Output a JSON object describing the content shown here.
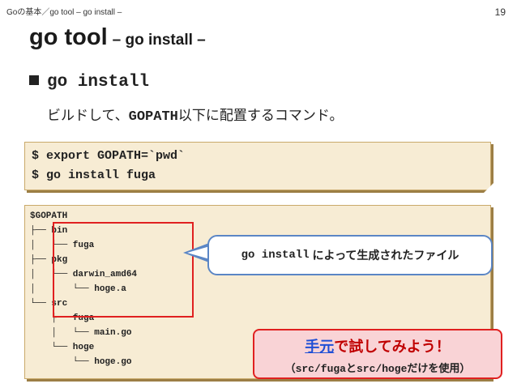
{
  "header": {
    "breadcrumb": "Goの基本／go tool – go install –",
    "page_number": "19"
  },
  "title": {
    "main": "go tool",
    "sub": "– go install –"
  },
  "bullet": {
    "text": "go install"
  },
  "description": {
    "before": "ビルドして、",
    "code": "GOPATH",
    "after": "以下に配置するコマンド。"
  },
  "commands": [
    "$ export GOPATH=`pwd`",
    "$ go install fuga"
  ],
  "tree": [
    "$GOPATH",
    "├── bin",
    "│   └── fuga",
    "├── pkg",
    "│   └── darwin_amd64",
    "│       └── hoge.a",
    "└── src",
    "    ├── fuga",
    "    │   └── main.go",
    "    └── hoge",
    "        └── hoge.go"
  ],
  "callout": {
    "code": "go install",
    "text": "によって生成されたファイル"
  },
  "note": {
    "line1_highlight": "手元",
    "line1_rest": "で試してみよう！",
    "line2": "（src/fugaとsrc/hogeだけを使用）"
  },
  "colors": {
    "box_bg": "#f7ecd4",
    "red": "#e02020",
    "blue": "#5b86c5",
    "note_bg": "#f9d3d6"
  }
}
